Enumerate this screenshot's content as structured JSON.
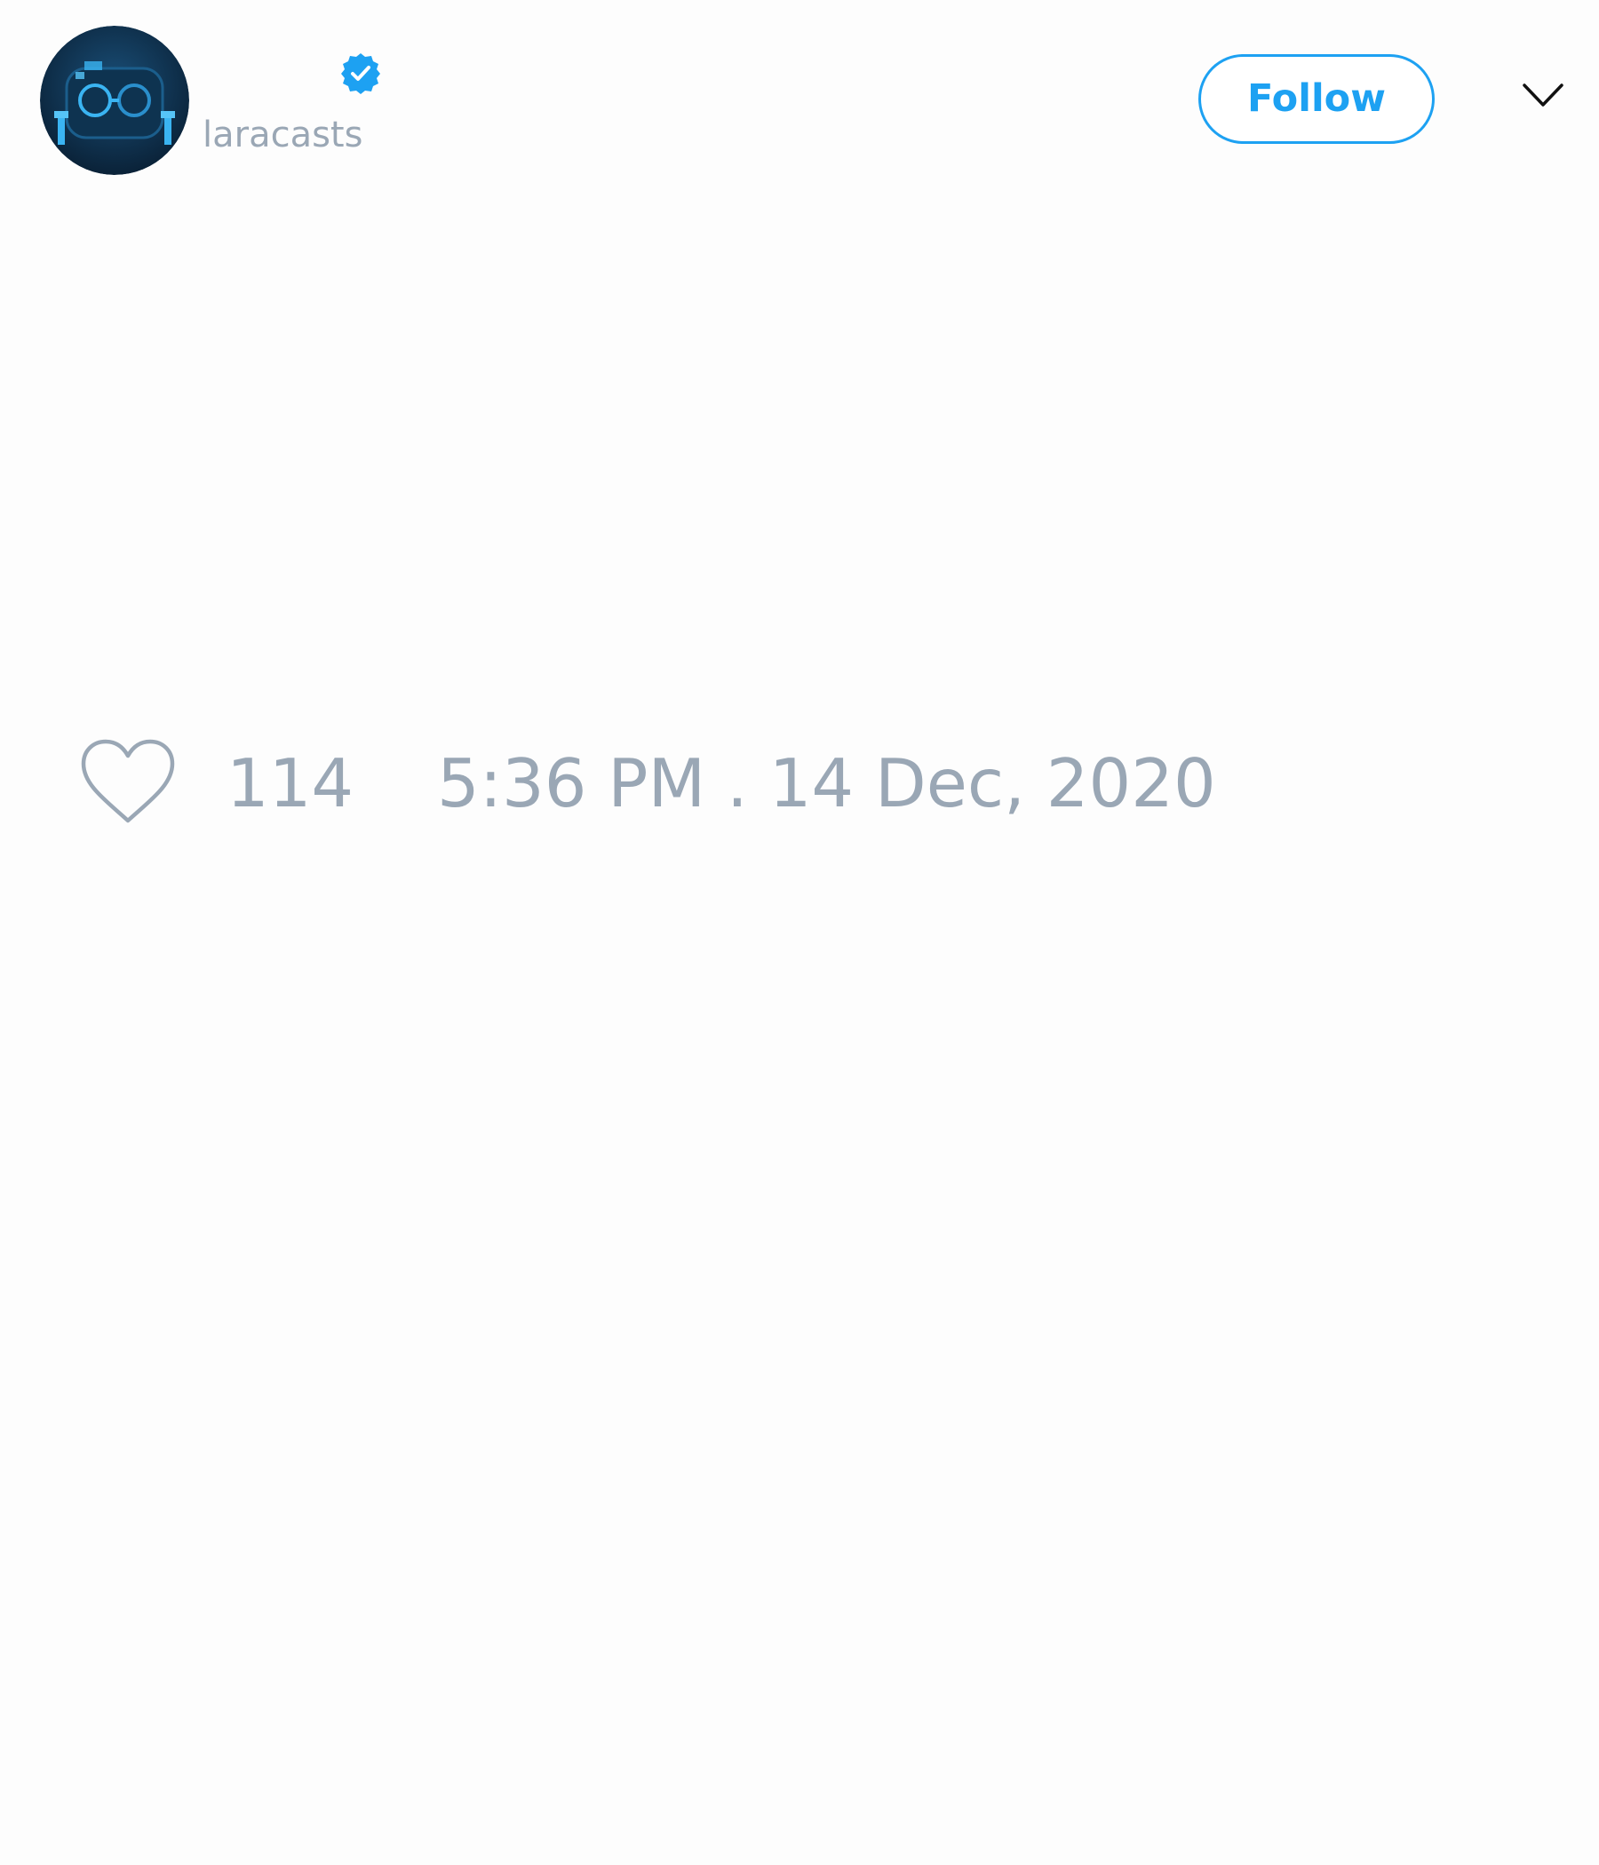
{
  "tweet": {
    "author": {
      "handle": "laracasts",
      "verified": true,
      "avatar_icon": "laracasts-logo-avatar"
    },
    "follow_label": "Follow",
    "menu_icon": "chevron-down-icon",
    "likes": {
      "icon": "heart-icon",
      "count": "114"
    },
    "timestamp": "5:36 PM . 14 Dec, 2020"
  },
  "colors": {
    "accent": "#1da1f2",
    "muted_text": "#9aa7b5",
    "avatar_bg": "#0b2c47",
    "background": "#fdfdfd"
  }
}
